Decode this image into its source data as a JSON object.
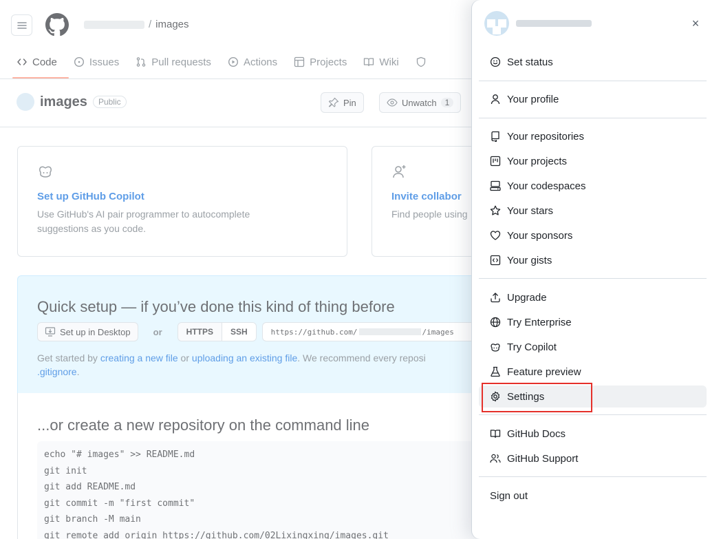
{
  "header": {
    "repo_name": "images",
    "separator": "/"
  },
  "tabs": [
    {
      "label": "Code",
      "icon": "code-icon"
    },
    {
      "label": "Issues",
      "icon": "issue-icon"
    },
    {
      "label": "Pull requests",
      "icon": "pull-request-icon"
    },
    {
      "label": "Actions",
      "icon": "play-icon"
    },
    {
      "label": "Projects",
      "icon": "table-icon"
    },
    {
      "label": "Wiki",
      "icon": "book-icon"
    }
  ],
  "repo": {
    "name": "images",
    "visibility": "Public",
    "pin_label": "Pin",
    "unwatch_label": "Unwatch",
    "watch_count": "1"
  },
  "cards": {
    "copilot": {
      "title": "Set up GitHub Copilot",
      "desc1": "Use GitHub's AI pair programmer to autocomplete",
      "desc2": "suggestions as you code."
    },
    "invite": {
      "title": "Invite collabor",
      "desc1": "Find people using"
    }
  },
  "quick_setup": {
    "title": "Quick setup — if you’ve done this kind of thing before",
    "desktop_label": "Set up in Desktop",
    "or_label": "or",
    "https_label": "HTTPS",
    "ssh_label": "SSH",
    "url_prefix": "https://github.com/",
    "url_suffix": "/images",
    "help_start": "Get started by ",
    "help_link1": "creating a new file",
    "help_mid": " or ",
    "help_link2": "uploading an existing file",
    "help_end": ". We recommend every reposi",
    "help_link3": ".gitignore",
    "help_tail": "."
  },
  "cmdline": {
    "title": "...or create a new repository on the command line",
    "lines": [
      "echo \"# images\" >> README.md",
      "git init",
      "git add README.md",
      "git commit -m \"first commit\"",
      "git branch -M main",
      "git remote add origin https://github.com/02Lixingxing/images.git"
    ]
  },
  "menu": {
    "close_label": "×",
    "items": [
      {
        "label": "Set status",
        "icon": "smiley-icon"
      },
      {
        "label": "Your profile",
        "icon": "person-icon"
      },
      {
        "label": "Your repositories",
        "icon": "repo-icon"
      },
      {
        "label": "Your projects",
        "icon": "project-icon"
      },
      {
        "label": "Your codespaces",
        "icon": "codespaces-icon"
      },
      {
        "label": "Your stars",
        "icon": "star-icon"
      },
      {
        "label": "Your sponsors",
        "icon": "heart-icon"
      },
      {
        "label": "Your gists",
        "icon": "code-square-icon"
      },
      {
        "label": "Upgrade",
        "icon": "upload-icon"
      },
      {
        "label": "Try Enterprise",
        "icon": "globe-icon"
      },
      {
        "label": "Try Copilot",
        "icon": "copilot-icon"
      },
      {
        "label": "Feature preview",
        "icon": "beaker-icon"
      },
      {
        "label": "Settings",
        "icon": "gear-icon"
      },
      {
        "label": "GitHub Docs",
        "icon": "book-icon"
      },
      {
        "label": "GitHub Support",
        "icon": "people-icon"
      },
      {
        "label": "Sign out",
        "icon": ""
      }
    ]
  },
  "colors": {
    "link": "#0969da",
    "highlight": "#e5302a",
    "quick_setup_bg": "#ddf4ff"
  }
}
